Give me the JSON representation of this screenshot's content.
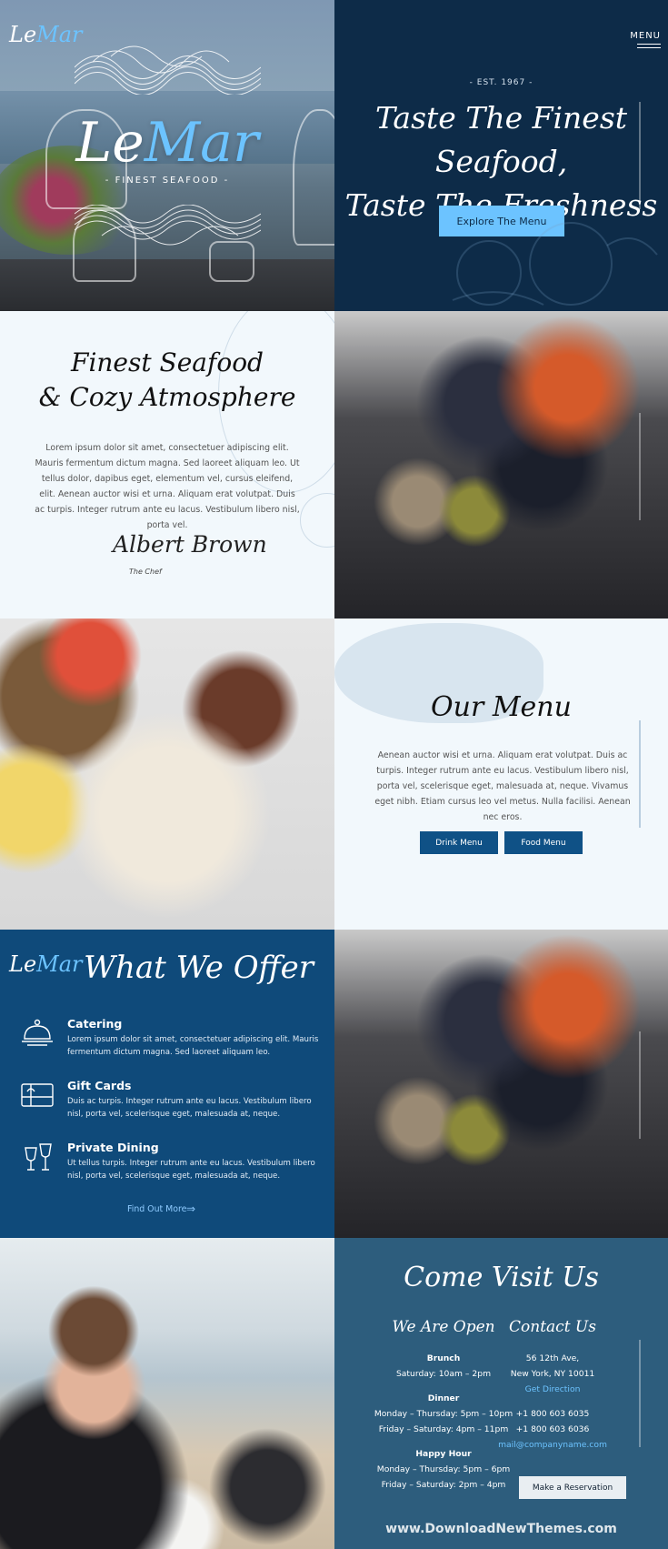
{
  "hero": {
    "logo_le": "Le",
    "logo_mar": "Mar",
    "tagline": "- FINEST SEAFOOD -",
    "menu_label": "MENU",
    "est": "- EST. 1967 -",
    "title_line1": "Taste The Finest Seafood,",
    "title_line2": "Taste The Freshness",
    "cta": "Explore The Menu"
  },
  "about": {
    "title_line1": "Finest Seafood",
    "title_line2": "& Cozy Atmosphere",
    "text": "Lorem ipsum dolor sit amet, consectetuer adipiscing elit. Mauris fermentum dictum magna. Sed laoreet aliquam leo. Ut tellus dolor, dapibus eget, elementum vel, cursus eleifend, elit. Aenean auctor wisi et urna. Aliquam erat volutpat. Duis ac turpis. Integer rutrum ante eu lacus. Vestibulum libero nisl, porta vel.",
    "signature": "Albert Brown",
    "chef_label": "The Chef"
  },
  "menu": {
    "title": "Our Menu",
    "text": "Aenean auctor wisi et urna. Aliquam erat volutpat. Duis ac turpis. Integer rutrum ante eu lacus. Vestibulum libero nisl, porta vel, scelerisque eget, malesuada at, neque. Vivamus eget nibh. Etiam cursus leo vel metus. Nulla facilisi. Aenean nec eros.",
    "drink_button": "Drink Menu",
    "food_button": "Food Menu"
  },
  "offer": {
    "logo_le": "Le",
    "logo_mar": "Mar",
    "title": "What We Offer",
    "items": [
      {
        "icon": "cloche-icon",
        "title": "Catering",
        "text": "Lorem ipsum dolor sit amet, consectetuer adipiscing elit. Mauris fermentum dictum magna. Sed laoreet aliquam leo."
      },
      {
        "icon": "gift-card-icon",
        "title": "Gift Cards",
        "text": "Duis ac turpis. Integer rutrum ante eu lacus. Vestibulum libero nisl, porta vel, scelerisque eget, malesuada at, neque."
      },
      {
        "icon": "wine-glasses-icon",
        "title": "Private Dining",
        "text": "Ut tellus turpis. Integer rutrum ante eu lacus. Vestibulum libero nisl, porta vel, scelerisque eget, malesuada at, neque."
      }
    ],
    "find_more": "Find Out More"
  },
  "visit": {
    "title": "Come Visit Us",
    "open_title": "We Are Open",
    "contact_title": "Contact Us",
    "brunch_head": "Brunch",
    "brunch_hours": "Saturday: 10am – 2pm",
    "dinner_head": "Dinner",
    "dinner_hours_1": "Monday – Thursday: 5pm – 10pm",
    "dinner_hours_2": "Friday – Saturday: 4pm – 11pm",
    "happy_head": "Happy Hour",
    "happy_hours_1": "Monday – Thursday: 5pm – 6pm",
    "happy_hours_2": "Friday – Saturday: 2pm – 4pm",
    "address_1": "56 12th Ave,",
    "address_2": "New York, NY 10011",
    "directions": "Get Direction",
    "phone_1": "+1 800 603 6035",
    "phone_2": "+1 800 603 6036",
    "email": "mail@companyname.com",
    "reserve": "Make a Reservation",
    "watermark": "www.DownloadNewThemes.com"
  },
  "colors": {
    "navy": "#0d2b48",
    "accent": "#6cc3ff",
    "offer_bg": "#0f4a7a",
    "visit_bg": "#2d5d7d",
    "light_bg": "#f2f8fc",
    "button_blue": "#0f5186"
  }
}
